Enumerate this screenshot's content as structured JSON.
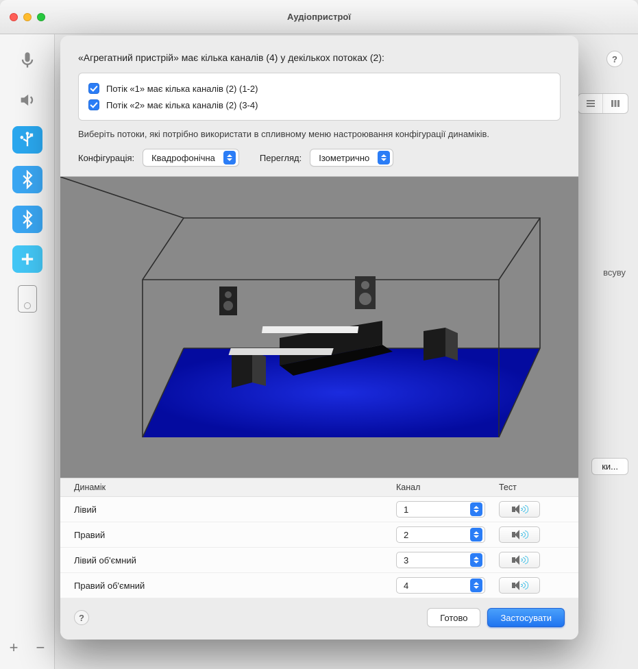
{
  "window": {
    "title": "Аудіопристрої"
  },
  "parent": {
    "help_tooltip": "?",
    "stray_label": "всуву",
    "stray_button": "ки..."
  },
  "sheet": {
    "heading": "«Агрегатний пристрій» має кілька каналів (4) у декількох потоках (2):",
    "streams": [
      {
        "checked": true,
        "label": "Потік «1» має кілька каналів (2) (1-2)"
      },
      {
        "checked": true,
        "label": "Потік «2» має кілька каналів (2) (3-4)"
      }
    ],
    "hint": "Виберіть потоки, які потрібно використати в спливному меню настроювання конфігурації динаміків.",
    "config_label": "Конфігурація:",
    "config_value": "Квадрофонічна",
    "view_label": "Перегляд:",
    "view_value": "Ізометрично",
    "table": {
      "header_speaker": "Динамік",
      "header_channel": "Канал",
      "header_test": "Тест",
      "rows": [
        {
          "name": "Лівий",
          "channel": "1"
        },
        {
          "name": "Правий",
          "channel": "2"
        },
        {
          "name": "Лівий об'ємний",
          "channel": "3"
        },
        {
          "name": "Правий об'ємний",
          "channel": "4"
        }
      ]
    },
    "footer": {
      "help": "?",
      "done": "Готово",
      "apply": "Застосувати"
    }
  }
}
